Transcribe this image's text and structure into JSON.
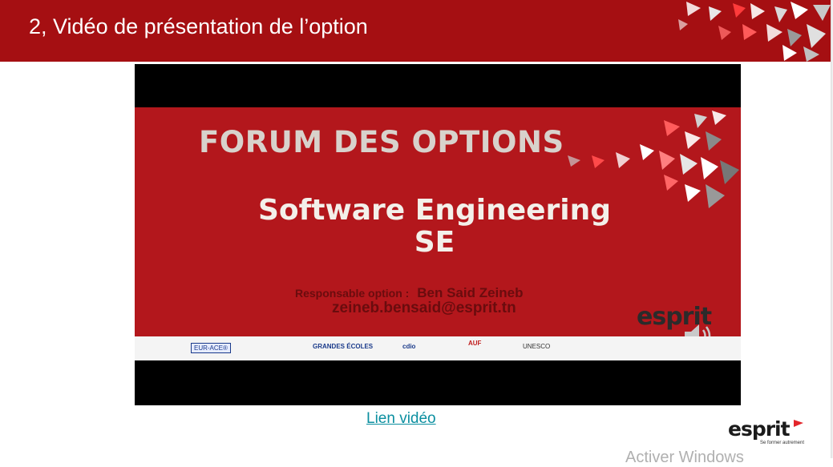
{
  "header": {
    "title": "2, Vidéo de présentation de l’option"
  },
  "video": {
    "slide_heading": "FORUM DES OPTIONS",
    "slide_title": "Software Engineering",
    "slide_subtitle": "SE",
    "responsible_label": "Responsable option :",
    "responsible_name": "Ben Said  Zeineb",
    "email": "zeineb.bensaid@esprit.tn",
    "logo_text": "esprit",
    "partners": [
      "EUR-ACE®",
      "GRANDES ÉCOLES",
      "cdio",
      "AUF",
      "UNESCO"
    ]
  },
  "link": {
    "label": "Lien vidéo "
  },
  "footer": {
    "logo_text": "esprit",
    "tagline": "Se former autrement"
  },
  "watermark": {
    "text": "Activer Windows"
  },
  "colors": {
    "header_bg": "#a50f12",
    "slide_bg": "#b3171c",
    "link": "#0b8fa0"
  }
}
